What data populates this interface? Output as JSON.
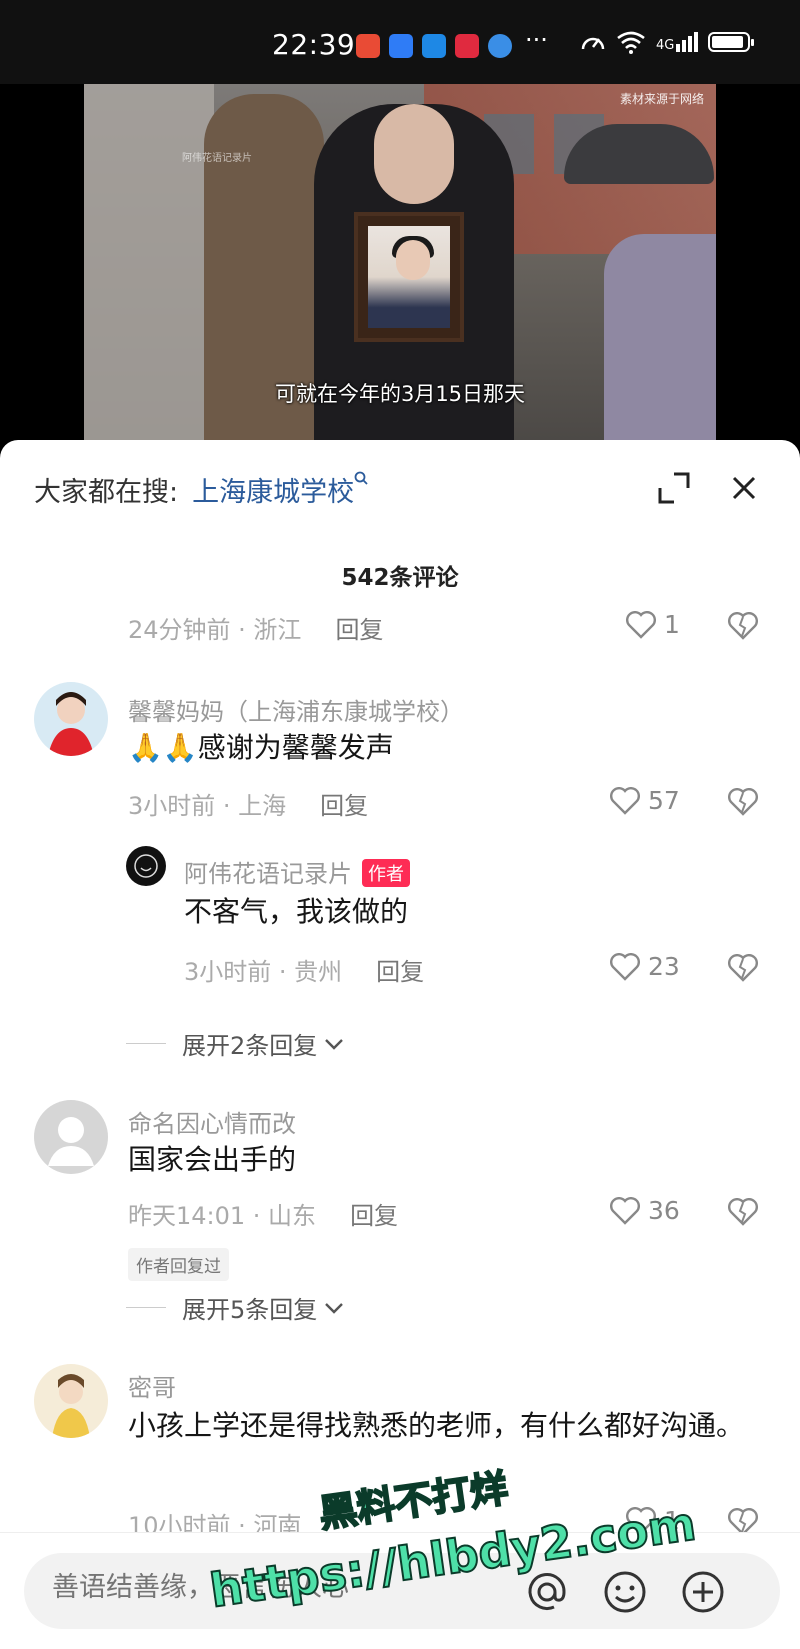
{
  "status_bar": {
    "time": "22:39",
    "app_icons": [
      {
        "name": "taobao-app-icon",
        "color": "#e94b35"
      },
      {
        "name": "message-app-icon",
        "color": "#2f7cf6"
      },
      {
        "name": "shield-app-icon",
        "color": "#1e88e5"
      },
      {
        "name": "xiaohongshu-app-icon",
        "color": "#e02a3f"
      },
      {
        "name": "browser-app-icon",
        "color": "#3a8ee6"
      }
    ],
    "more": "···",
    "network": "4G"
  },
  "video": {
    "watermark": "素材来源于网络",
    "small_mark": "阿伟花语记录片",
    "subtitle": "可就在今年的3月15日那天"
  },
  "header": {
    "search_prefix": "大家都在搜:",
    "search_term": "上海康城学校",
    "count": "542条评论"
  },
  "comments": {
    "partial": {
      "meta": "24分钟前 · 浙江",
      "reply": "回复",
      "likes": "1"
    },
    "c1": {
      "user": "馨馨妈妈（上海浦东康城学校）",
      "text": "🙏🙏感谢为馨馨发声",
      "meta": "3小时前 · 上海",
      "reply": "回复",
      "likes": "57",
      "sub": {
        "user": "阿伟花语记录片",
        "badge": "作者",
        "text": "不客气，我该做的",
        "meta": "3小时前 · 贵州",
        "reply": "回复",
        "likes": "23"
      },
      "expand": "展开2条回复"
    },
    "c2": {
      "user": "命名因心情而改",
      "text": "国家会出手的",
      "meta": "昨天14:01 · 山东",
      "reply": "回复",
      "likes": "36",
      "tag": "作者回复过",
      "expand": "展开5条回复"
    },
    "c3": {
      "user": "密哥",
      "text": "小孩上学还是得找熟悉的老师，有什么都好沟通。",
      "meta": "10小时前 · 河南",
      "likes": "1"
    }
  },
  "input": {
    "placeholder": "善语结善缘，恶言伤人心"
  },
  "overlay": {
    "line1": "黑料不打烊",
    "line2": "https://hlbdy2.com"
  },
  "colors": {
    "accent_link": "#2b5b9b",
    "author_badge": "#fe2c55",
    "overlay_text": "#4ee0a8"
  }
}
